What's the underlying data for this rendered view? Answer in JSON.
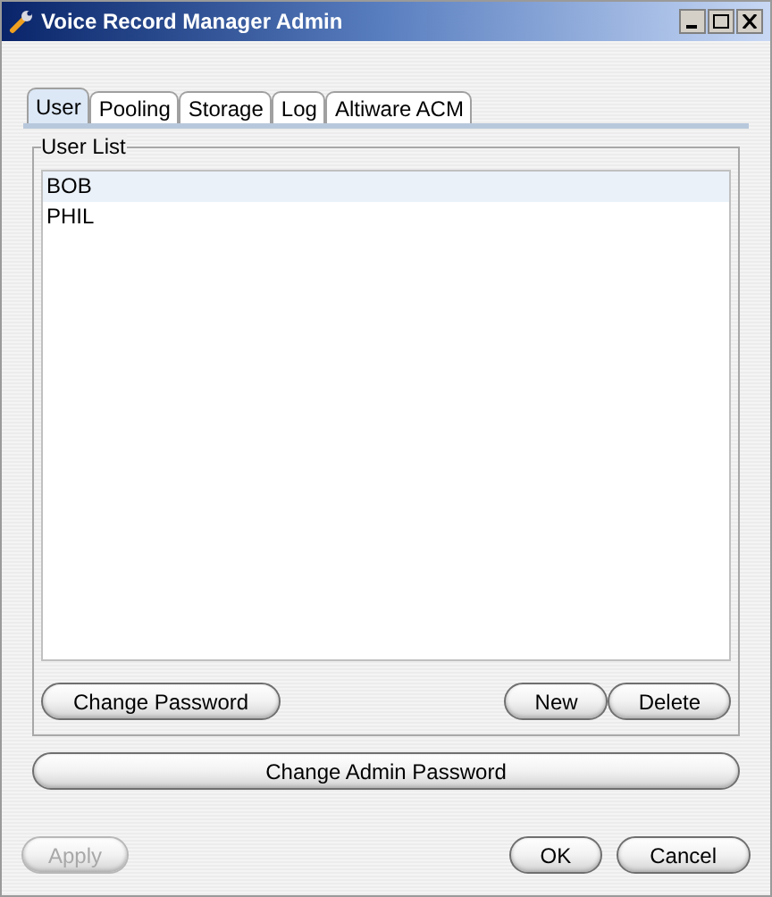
{
  "window": {
    "title": "Voice Record Manager Admin"
  },
  "tabs": [
    {
      "label": "User",
      "selected": true
    },
    {
      "label": "Pooling",
      "selected": false
    },
    {
      "label": "Storage",
      "selected": false
    },
    {
      "label": "Log",
      "selected": false
    },
    {
      "label": "Altiware ACM",
      "selected": false
    }
  ],
  "user_list": {
    "title": "User List",
    "users": [
      {
        "name": "BOB",
        "selected": true
      },
      {
        "name": "PHIL",
        "selected": false
      }
    ]
  },
  "list_buttons": {
    "left": [
      {
        "label": "Change Password",
        "disabled": false
      }
    ],
    "right": [
      {
        "label": "New",
        "disabled": false
      },
      {
        "label": "Delete",
        "disabled": false
      }
    ]
  },
  "admin_button": {
    "label": "Change Admin Password",
    "disabled": false
  },
  "dialog_buttons": {
    "left": [
      {
        "label": "Apply",
        "disabled": true
      }
    ],
    "right": [
      {
        "label": "OK",
        "disabled": false
      },
      {
        "label": "Cancel",
        "disabled": false
      }
    ]
  }
}
